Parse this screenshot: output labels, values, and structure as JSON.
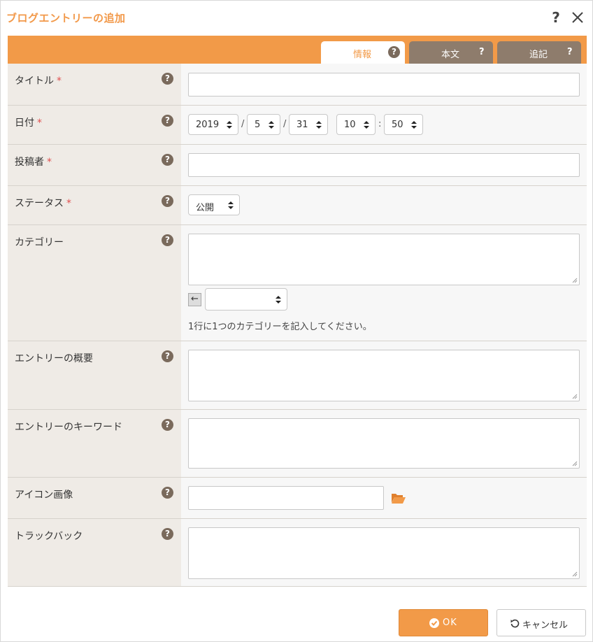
{
  "dialog": {
    "title": "ブログエントリーの追加",
    "help_label": "?",
    "close_label": "close"
  },
  "tabs": [
    {
      "label": "情報",
      "help": "?",
      "active": true
    },
    {
      "label": "本文",
      "help": "?",
      "active": false
    },
    {
      "label": "追記",
      "help": "?",
      "active": false
    }
  ],
  "fields": {
    "title": {
      "label": "タイトル",
      "required": "*",
      "help": "?",
      "value": ""
    },
    "date": {
      "label": "日付",
      "required": "*",
      "help": "?",
      "year": "2019",
      "month": "5",
      "day": "31",
      "hour": "10",
      "minute": "50",
      "date_sep": "/",
      "time_sep": ":"
    },
    "author": {
      "label": "投稿者",
      "required": "*",
      "help": "?",
      "value": ""
    },
    "status": {
      "label": "ステータス",
      "required": "*",
      "help": "?",
      "value": "公開"
    },
    "category": {
      "label": "カテゴリー",
      "help": "?",
      "value": "",
      "arrow_label": "←",
      "select_value": "",
      "hint": "1行に1つのカテゴリーを記入してください。"
    },
    "summary": {
      "label": "エントリーの概要",
      "help": "?",
      "value": ""
    },
    "keywords": {
      "label": "エントリーのキーワード",
      "help": "?",
      "value": ""
    },
    "icon_image": {
      "label": "アイコン画像",
      "help": "?",
      "value": ""
    },
    "trackback": {
      "label": "トラックバック",
      "help": "?",
      "value": ""
    }
  },
  "buttons": {
    "ok": "OK",
    "cancel": "キャンセル"
  },
  "colors": {
    "accent": "#f29a48",
    "tab_inactive": "#8e7c6c",
    "label_bg": "#efebe6",
    "required": "#e05050"
  }
}
